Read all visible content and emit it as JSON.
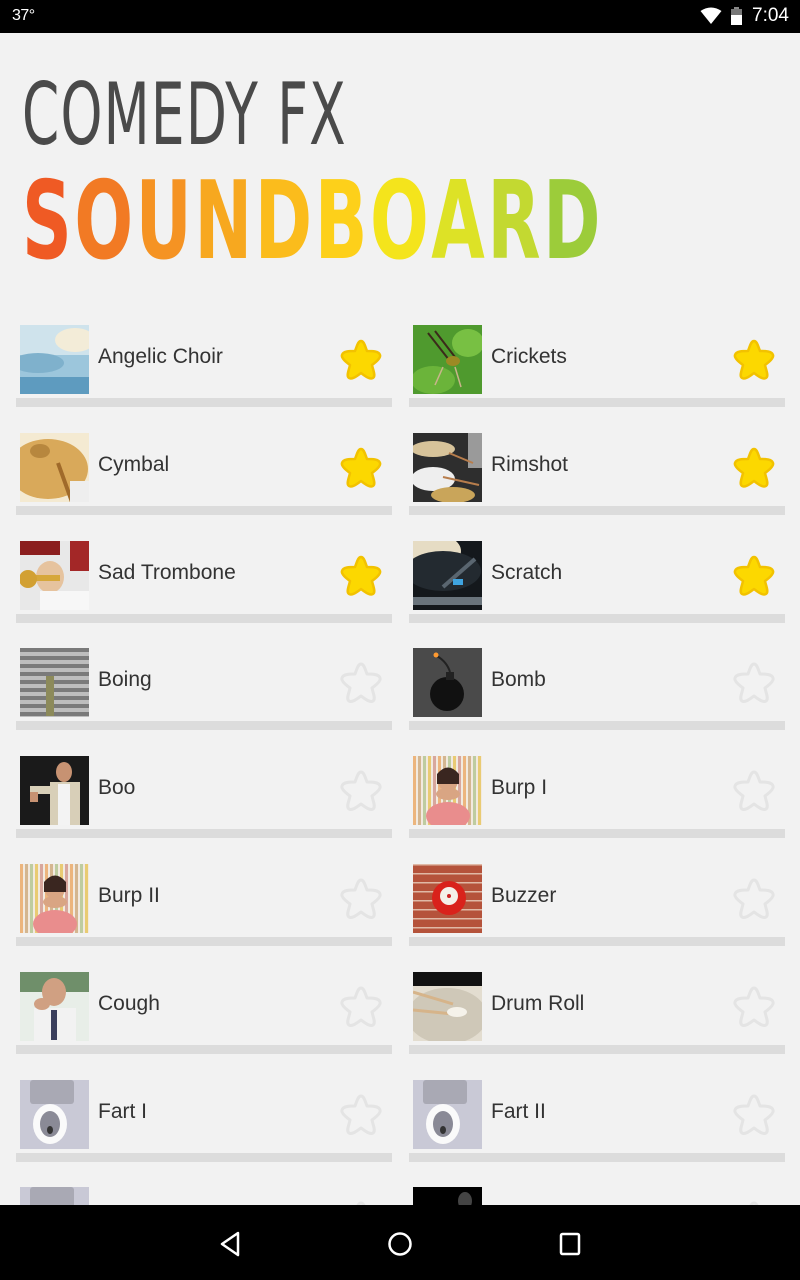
{
  "status_bar": {
    "temperature": "37°",
    "time": "7:04",
    "icons": [
      "wifi-icon",
      "battery-icon"
    ],
    "battery_level": 0.6
  },
  "logo": {
    "line1": "COMEDY FX",
    "line2_letters": [
      "S",
      "O",
      "U",
      "N",
      "D",
      "B",
      "O",
      "A",
      "R",
      "D"
    ],
    "line2_colors": [
      "#ef5a24",
      "#f27a24",
      "#f59323",
      "#f7a81f",
      "#fbbc1c",
      "#fdd01a",
      "#f4e41c",
      "#dde226",
      "#c3d931",
      "#9ccc3a"
    ],
    "line1_color": "#4a4a4a"
  },
  "colors": {
    "star_active": "#fcd800",
    "star_active_outline": "#f2c200",
    "star_inactive": "#e4e4e4",
    "background": "#f2f2f2",
    "card_shadow": "#dcdcdc"
  },
  "sounds": [
    {
      "label": "Angelic Choir",
      "favorite": true,
      "thumb": "clouds"
    },
    {
      "label": "Crickets",
      "favorite": true,
      "thumb": "cricket"
    },
    {
      "label": "Cymbal",
      "favorite": true,
      "thumb": "cymbal"
    },
    {
      "label": "Rimshot",
      "favorite": true,
      "thumb": "drums"
    },
    {
      "label": "Sad Trombone",
      "favorite": true,
      "thumb": "trombone"
    },
    {
      "label": "Scratch",
      "favorite": true,
      "thumb": "turntable"
    },
    {
      "label": "Boing",
      "favorite": false,
      "thumb": "springs"
    },
    {
      "label": "Bomb",
      "favorite": false,
      "thumb": "bomb"
    },
    {
      "label": "Boo",
      "favorite": false,
      "thumb": "thumbs-down-man"
    },
    {
      "label": "Burp I",
      "favorite": false,
      "thumb": "woman-stripes"
    },
    {
      "label": "Burp II",
      "favorite": false,
      "thumb": "woman-stripes"
    },
    {
      "label": "Buzzer",
      "favorite": false,
      "thumb": "buzzer"
    },
    {
      "label": "Cough",
      "favorite": false,
      "thumb": "coughing-man"
    },
    {
      "label": "Drum Roll",
      "favorite": false,
      "thumb": "snare"
    },
    {
      "label": "Fart I",
      "favorite": false,
      "thumb": "toilet"
    },
    {
      "label": "Fart II",
      "favorite": false,
      "thumb": "toilet"
    },
    {
      "label": "",
      "favorite": false,
      "thumb": "toilet"
    },
    {
      "label": "",
      "favorite": false,
      "thumb": "dark"
    }
  ],
  "nav_bar": {
    "buttons": [
      "back",
      "home",
      "recents"
    ]
  }
}
